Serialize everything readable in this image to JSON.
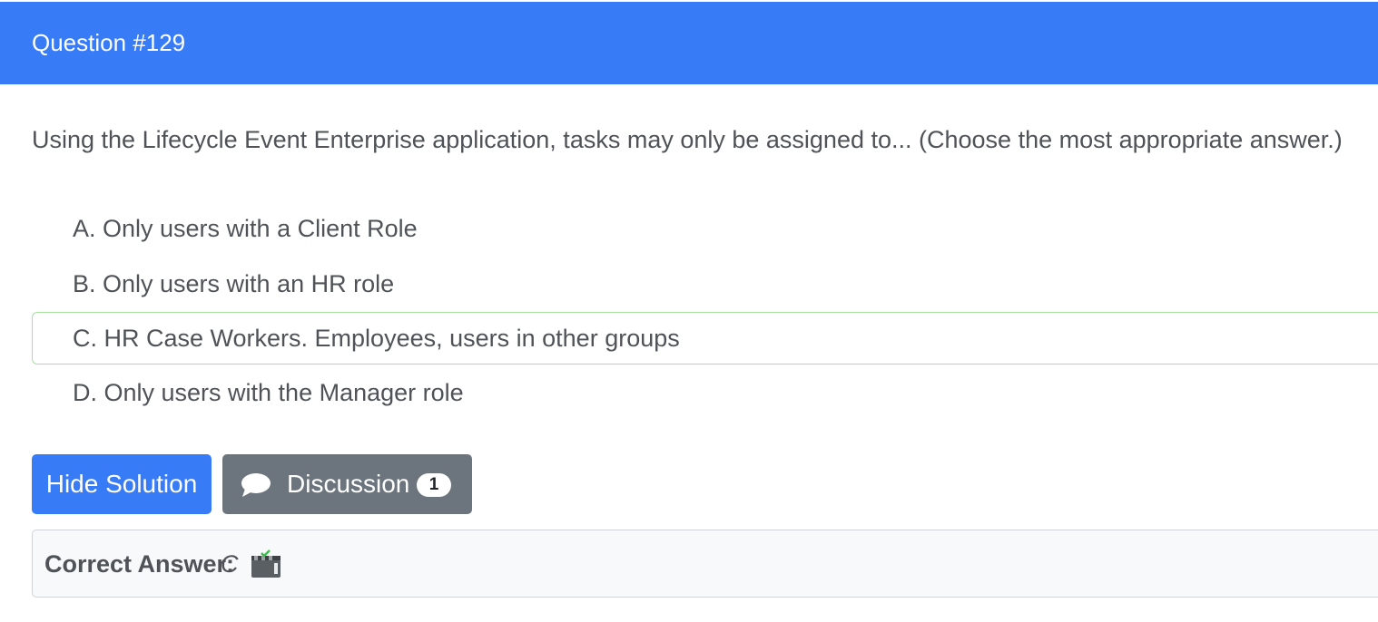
{
  "header": {
    "title": "Question #129"
  },
  "question": {
    "text": "Using the Lifecycle Event Enterprise application, tasks may only be assigned to... (Choose the most appropriate answer.)"
  },
  "choices": [
    {
      "label": "A. Only users with a Client Role",
      "correct": false
    },
    {
      "label": "B. Only users with an HR role",
      "correct": false
    },
    {
      "label": "C. HR Case Workers. Employees, users in other groups",
      "correct": true
    },
    {
      "label": "D. Only users with the Manager role",
      "correct": false
    }
  ],
  "buttons": {
    "hide_solution": "Hide Solution",
    "discussion": "Discussion",
    "discussion_count": "1",
    "discussion_icon": "chat-bubble-icon"
  },
  "solution": {
    "label": "Correct Answer:",
    "value": "C",
    "icon": "clapperboard-check-icon"
  },
  "colors": {
    "primary": "#377bf7",
    "secondary": "#6c757d",
    "correct_border": "#a8e0a0"
  }
}
